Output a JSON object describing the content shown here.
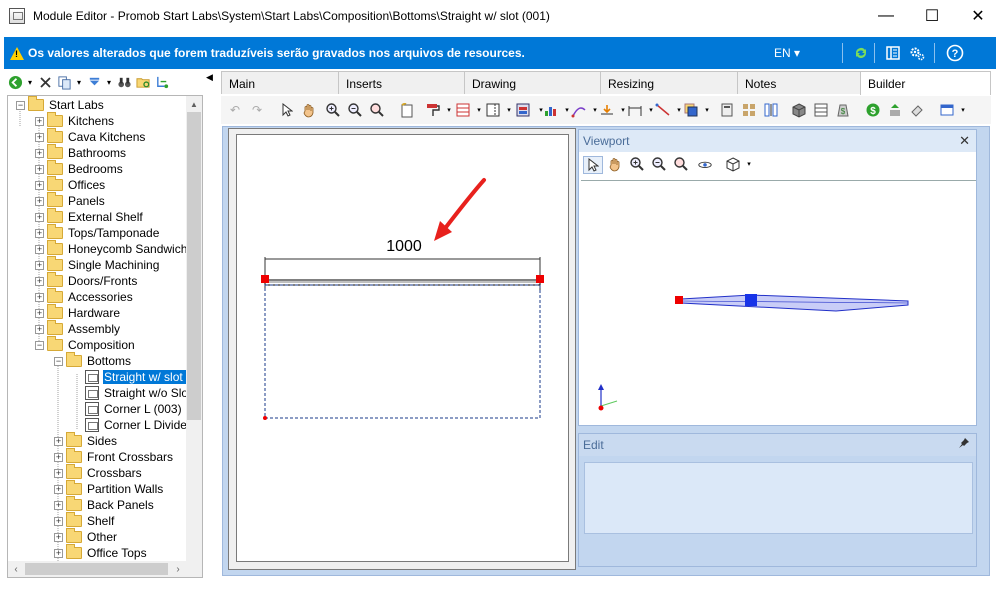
{
  "window": {
    "title": "Module Editor - Promob Start Labs\\System\\Start Labs\\Composition\\Bottoms\\Straight w/ slot (001)",
    "minimize": "—",
    "maximize": "☐",
    "close": "✕"
  },
  "infobar": {
    "message": "Os valores alterados que forem traduzíveis serão gravados nos arquivos de resources.",
    "language": "EN ▾",
    "accent": "#0078d7"
  },
  "tree": {
    "items": [
      {
        "label": "Start Labs",
        "level": 0,
        "expander": "−",
        "icon": "folder-open-icon"
      },
      {
        "label": "Kitchens",
        "level": 1,
        "expander": "+",
        "icon": "folder-icon"
      },
      {
        "label": "Cava Kitchens",
        "level": 1,
        "expander": "+",
        "icon": "folder-icon"
      },
      {
        "label": "Bathrooms",
        "level": 1,
        "expander": "+",
        "icon": "folder-icon"
      },
      {
        "label": "Bedrooms",
        "level": 1,
        "expander": "+",
        "icon": "folder-icon"
      },
      {
        "label": "Offices",
        "level": 1,
        "expander": "+",
        "icon": "folder-icon"
      },
      {
        "label": "Panels",
        "level": 1,
        "expander": "+",
        "icon": "folder-icon"
      },
      {
        "label": "External Shelf",
        "level": 1,
        "expander": "+",
        "icon": "folder-icon"
      },
      {
        "label": "Tops/Tamponade",
        "level": 1,
        "expander": "+",
        "icon": "folder-icon"
      },
      {
        "label": "Honeycomb Sandwich",
        "level": 1,
        "expander": "+",
        "icon": "folder-icon"
      },
      {
        "label": "Single Machining",
        "level": 1,
        "expander": "+",
        "icon": "folder-icon"
      },
      {
        "label": "Doors/Fronts",
        "level": 1,
        "expander": "+",
        "icon": "folder-icon"
      },
      {
        "label": "Accessories",
        "level": 1,
        "expander": "+",
        "icon": "folder-icon"
      },
      {
        "label": "Hardware",
        "level": 1,
        "expander": "+",
        "icon": "folder-icon"
      },
      {
        "label": "Assembly",
        "level": 1,
        "expander": "+",
        "icon": "folder-icon"
      },
      {
        "label": "Composition",
        "level": 1,
        "expander": "−",
        "icon": "folder-open-icon"
      },
      {
        "label": "Bottoms",
        "level": 2,
        "expander": "−",
        "icon": "folder-open-icon"
      },
      {
        "label": "Straight w/ slot (",
        "level": 3,
        "expander": "",
        "icon": "module-icon",
        "selected": true
      },
      {
        "label": "Straight w/o Slot",
        "level": 3,
        "expander": "",
        "icon": "module-icon"
      },
      {
        "label": "Corner L (003)",
        "level": 3,
        "expander": "",
        "icon": "module-icon"
      },
      {
        "label": "Corner L Divider",
        "level": 3,
        "expander": "",
        "icon": "module-icon"
      },
      {
        "label": "Sides",
        "level": 2,
        "expander": "+",
        "icon": "folder-icon"
      },
      {
        "label": "Front Crossbars",
        "level": 2,
        "expander": "+",
        "icon": "folder-icon"
      },
      {
        "label": "Crossbars",
        "level": 2,
        "expander": "+",
        "icon": "folder-icon"
      },
      {
        "label": "Partition Walls",
        "level": 2,
        "expander": "+",
        "icon": "folder-icon"
      },
      {
        "label": "Back Panels",
        "level": 2,
        "expander": "+",
        "icon": "folder-icon"
      },
      {
        "label": "Shelf",
        "level": 2,
        "expander": "+",
        "icon": "folder-icon"
      },
      {
        "label": "Other",
        "level": 2,
        "expander": "+",
        "icon": "folder-icon"
      },
      {
        "label": "Office Tops",
        "level": 2,
        "expander": "+",
        "icon": "folder-icon"
      }
    ]
  },
  "tabs": [
    {
      "label": "Main"
    },
    {
      "label": "Inserts"
    },
    {
      "label": "Drawing"
    },
    {
      "label": "Resizing"
    },
    {
      "label": "Notes"
    },
    {
      "label": "Builder",
      "active": true
    }
  ],
  "drawing": {
    "dimension_label": "1000",
    "arrow_color": "#e8211d"
  },
  "viewport": {
    "title": "Viewport",
    "close": "✕"
  },
  "edit": {
    "title": "Edit",
    "pin": "📌"
  }
}
